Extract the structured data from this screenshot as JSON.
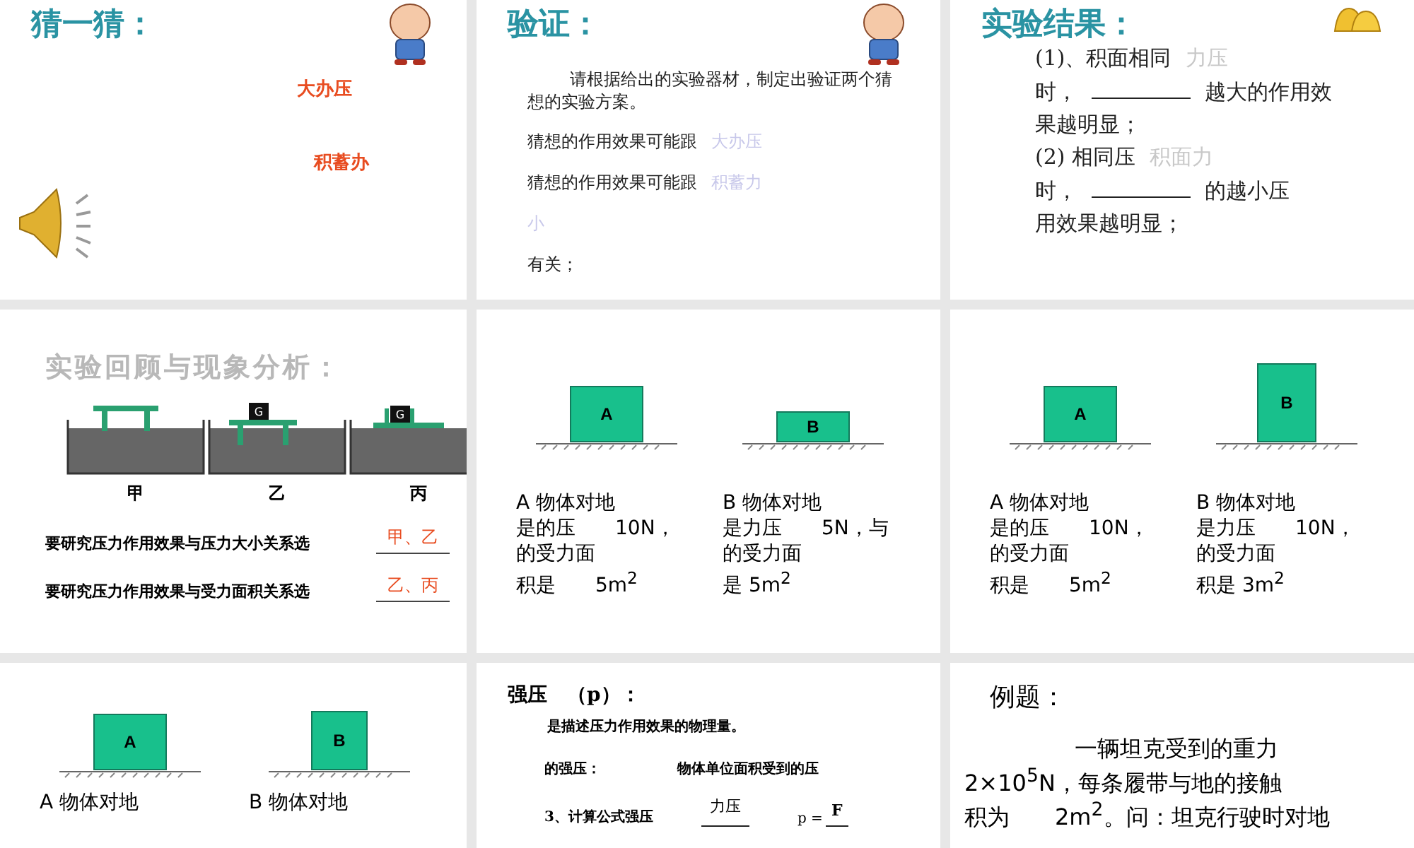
{
  "slides": [
    {
      "kind": "guess",
      "title": "猜一猜：",
      "answers": [
        "大办压",
        "积蓄办"
      ]
    },
    {
      "kind": "verify",
      "title": "验证：",
      "lines": [
        [
          {
            "kind": "normal",
            "text": "请根据给出的实验器材，制定出验证两个猜想的实验方案。"
          }
        ],
        [
          {
            "kind": "normal",
            "text": "猜想的作用效果可能跟"
          },
          {
            "kind": "faint",
            "text": "大办压"
          }
        ],
        [
          {
            "kind": "normal",
            "text": "猜想的作用效果可能跟"
          },
          {
            "kind": "faint",
            "text": "积蓄力"
          }
        ],
        [
          {
            "kind": "faint",
            "text": "小"
          }
        ],
        [
          {
            "kind": "normal",
            "text": "有关；"
          }
        ]
      ]
    },
    {
      "kind": "conclusion",
      "title": "实验结果：",
      "lines": [
        [
          {
            "kind": "normal",
            "text": "(1)、积面相同"
          },
          {
            "kind": "faint",
            "text": "力压"
          }
        ],
        [
          {
            "kind": "normal",
            "text": "时，"
          },
          {
            "kind": "blank"
          },
          {
            "kind": "normal",
            "text": "越大的作用效"
          }
        ],
        [
          {
            "kind": "normal",
            "text": "果越明显；"
          }
        ],
        [
          {
            "kind": "normal",
            "text": "(2) 相同压"
          },
          {
            "kind": "faint",
            "text": "积面力"
          }
        ],
        [
          {
            "kind": "normal",
            "text": "时，"
          },
          {
            "kind": "blank"
          },
          {
            "kind": "normal",
            "text": "的越小压"
          }
        ],
        [
          {
            "kind": "normal",
            "text": "用效果越明显；"
          }
        ]
      ]
    },
    {
      "kind": "review",
      "title": "实验回顾与现象分析：",
      "tanks": [
        {
          "kind": "table",
          "label": "甲"
        },
        {
          "kind": "weight_on_table",
          "label": "乙",
          "weight_label": "G"
        },
        {
          "kind": "weight_on_board",
          "label": "丙",
          "weight_label": "G"
        }
      ],
      "questions": [
        {
          "text": "要研究压力作用效果与压力大小关系选",
          "answer": "甲、乙"
        },
        {
          "text": "要研究压力作用效果与受力面积关系选",
          "answer": "乙、丙"
        }
      ]
    },
    {
      "kind": "compare",
      "objects": [
        {
          "label": "A",
          "kind": "wide",
          "caption": [
            "A 物体对地",
            "是的压　　10N，",
            "的受力面",
            "积是　　5m$^{2}$"
          ]
        },
        {
          "label": "B",
          "kind": "flat",
          "caption": [
            "B 物体对地",
            "是力压　　5N，与",
            "的受力面",
            "是 5m$^{2}$"
          ]
        }
      ]
    },
    {
      "kind": "compare",
      "objects": [
        {
          "label": "A",
          "kind": "wide",
          "caption": [
            "A 物体对地",
            "是的压　　10N，",
            "的受力面",
            "积是　　5m$^{2}$"
          ]
        },
        {
          "label": "B",
          "kind": "tall",
          "caption": [
            "B 物体对地",
            "是力压　　10N，",
            "的受力面",
            "积是 3m$^{2}$"
          ]
        }
      ]
    },
    {
      "kind": "compare",
      "objects": [
        {
          "label": "A",
          "kind": "wide",
          "caption": [
            "A 物体对地"
          ]
        },
        {
          "label": "B",
          "kind": "square",
          "caption": [
            "B 物体对地"
          ]
        }
      ]
    },
    {
      "kind": "formula",
      "title": "强压　（p）：",
      "definition": "是描述压力作用效果的物理量。",
      "meaning_label": "的强压：",
      "meaning": "物体单位面积受到的压",
      "formula_label": "3、计算公式强压",
      "numerator": "力压",
      "symbol": "p =",
      "symbol_numerator": "F"
    },
    {
      "kind": "example",
      "title": "例题：",
      "lines": [
        "一辆坦克受到的重力",
        "2×10$^{5}$N，每条履带与地的接触",
        "积为　　2m$^{2}$。问：坦克行驶时对地"
      ]
    }
  ]
}
